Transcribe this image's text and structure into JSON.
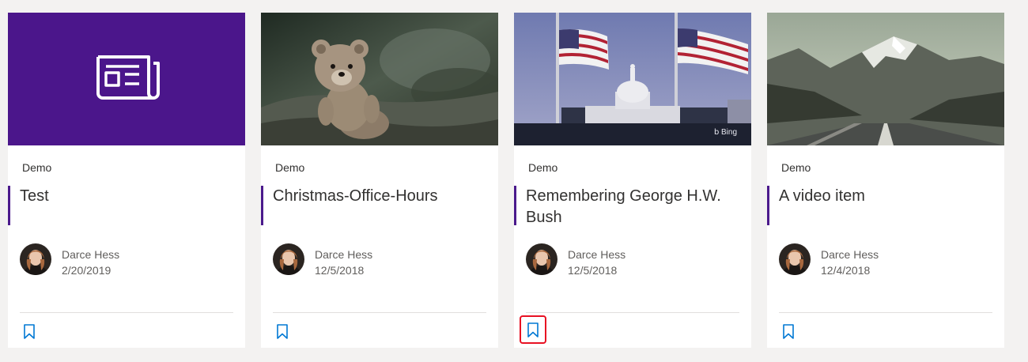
{
  "colors": {
    "page_bg": "#f3f2f1",
    "accent": "#4b1a8c",
    "news_tile_bg": "#4b168b",
    "bookmark_blue": "#0078d4",
    "focus_outline": "#e81123"
  },
  "cards": [
    {
      "site": "Demo",
      "title": "Test",
      "author": "Darce Hess",
      "date": "2/20/2019",
      "thumbnail": "news-placeholder-icon",
      "bookmark_icon": "bookmark-icon",
      "bookmark_focused": false
    },
    {
      "site": "Demo",
      "title": "Christmas-Office-Hours",
      "author": "Darce Hess",
      "date": "12/5/2018",
      "thumbnail": "teddy-bear-photo",
      "bookmark_icon": "bookmark-icon",
      "bookmark_focused": false
    },
    {
      "site": "Demo",
      "title": "Remembering George H.W. Bush",
      "author": "Darce Hess",
      "date": "12/5/2018",
      "thumbnail": "capitol-flags-photo",
      "thumbnail_watermark": "Bing",
      "bookmark_icon": "bookmark-icon",
      "bookmark_focused": true
    },
    {
      "site": "Demo",
      "title": "A video item",
      "author": "Darce Hess",
      "date": "12/4/2018",
      "thumbnail": "mountain-road-photo",
      "bookmark_icon": "bookmark-icon",
      "bookmark_focused": false
    }
  ]
}
